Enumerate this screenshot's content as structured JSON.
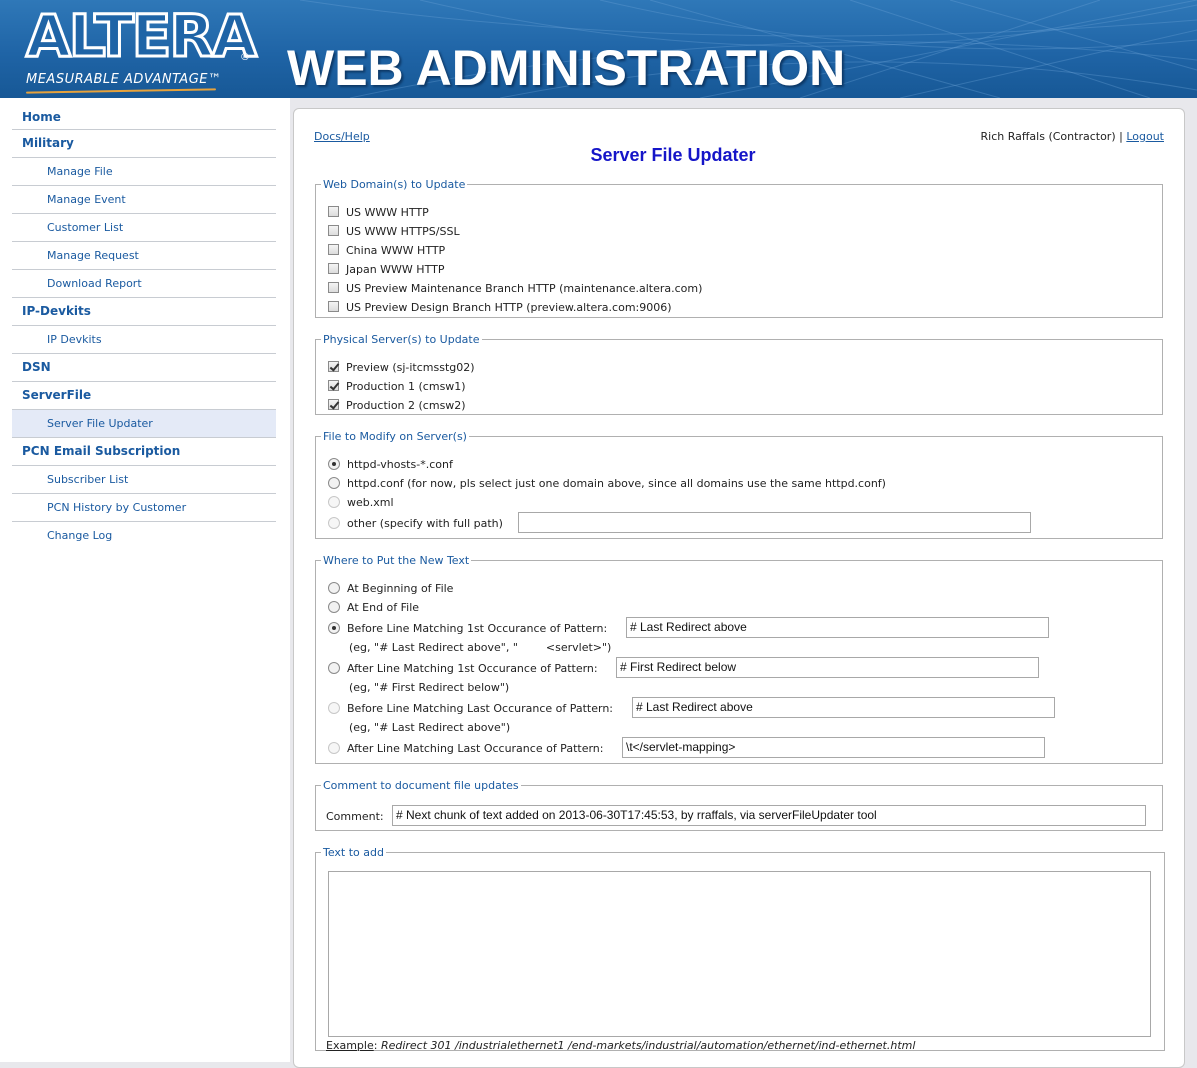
{
  "header": {
    "logo_text": "ALTERA",
    "logo_registered": "®",
    "logo_tagline": "MEASURABLE ADVANTAGE™",
    "title": "WEB ADMINISTRATION"
  },
  "sidebar": {
    "items": [
      {
        "label": "Home",
        "level": "top"
      },
      {
        "label": "Military",
        "level": "top"
      },
      {
        "label": "Manage File",
        "level": "sub"
      },
      {
        "label": "Manage Event",
        "level": "sub"
      },
      {
        "label": "Customer List",
        "level": "sub"
      },
      {
        "label": "Manage Request",
        "level": "sub"
      },
      {
        "label": "Download Report",
        "level": "sub"
      },
      {
        "label": "IP-Devkits",
        "level": "top"
      },
      {
        "label": "IP Devkits",
        "level": "sub"
      },
      {
        "label": "DSN",
        "level": "top"
      },
      {
        "label": "ServerFile",
        "level": "top"
      },
      {
        "label": "Server File Updater",
        "level": "sub",
        "active": true
      },
      {
        "label": "PCN Email Subscription",
        "level": "top"
      },
      {
        "label": "Subscriber List",
        "level": "sub"
      },
      {
        "label": "PCN History by Customer",
        "level": "sub"
      },
      {
        "label": "Change Log",
        "level": "sub"
      }
    ]
  },
  "main": {
    "docs_link": "Docs/Help",
    "user_name": "Rich Raffals (Contractor)",
    "separator": " | ",
    "logout": "Logout",
    "title": "Server File Updater",
    "web_domains": {
      "legend": "Web Domain(s) to Update",
      "options": [
        {
          "label": "US WWW HTTP",
          "checked": false
        },
        {
          "label": "US WWW HTTPS/SSL",
          "checked": false
        },
        {
          "label": "China WWW HTTP",
          "checked": false
        },
        {
          "label": "Japan WWW HTTP",
          "checked": false
        },
        {
          "label": "US Preview Maintenance Branch HTTP (maintenance.altera.com)",
          "checked": false
        },
        {
          "label": "US Preview Design Branch HTTP (preview.altera.com:9006)",
          "checked": false
        }
      ]
    },
    "physical_servers": {
      "legend": "Physical Server(s) to Update",
      "options": [
        {
          "label": "Preview (sj-itcmsstg02)",
          "checked": true
        },
        {
          "label": "Production 1 (cmsw1)",
          "checked": true
        },
        {
          "label": "Production 2 (cmsw2)",
          "checked": true
        }
      ]
    },
    "file_to_modify": {
      "legend": "File to Modify on Server(s)",
      "options": [
        {
          "label": "httpd-vhosts-*.conf",
          "selected": true
        },
        {
          "label": "httpd.conf (for now, pls select just one domain above, since all domains use the same httpd.conf)",
          "selected": false
        },
        {
          "label": "web.xml",
          "selected": false
        },
        {
          "label": "other (specify with full path)",
          "selected": false
        }
      ],
      "other_value": ""
    },
    "where_to_put": {
      "legend": "Where to Put the New Text",
      "at_beginning": "At Beginning of File",
      "at_end": "At End of File",
      "before_first": "Before Line Matching 1st Occurance of Pattern:",
      "before_first_value": "# Last Redirect above",
      "before_first_hint": "(eg, \"# Last Redirect above\", \"        <servlet>\")",
      "after_first": "After Line Matching 1st Occurance of Pattern:",
      "after_first_value": "# First Redirect below",
      "after_first_hint": "(eg, \"# First Redirect below\")",
      "before_last": "Before Line Matching Last Occurance of Pattern:",
      "before_last_value": "# Last Redirect above",
      "before_last_hint": "(eg, \"# Last Redirect above\")",
      "after_last": "After Line Matching Last Occurance of Pattern:",
      "after_last_value": "\\t</servlet-mapping>"
    },
    "comment": {
      "legend": "Comment to document file updates",
      "label": "Comment:",
      "value": "# Next chunk of text added on 2013-06-30T17:45:53, by rraffals, via serverFileUpdater tool"
    },
    "text_to_add": {
      "legend": "Text to add",
      "value": "",
      "example_label": "Example",
      "example_value": "Redirect 301 /industrialethernet1 /end-markets/industrial/automation/ethernet/ind-ethernet.html"
    }
  }
}
